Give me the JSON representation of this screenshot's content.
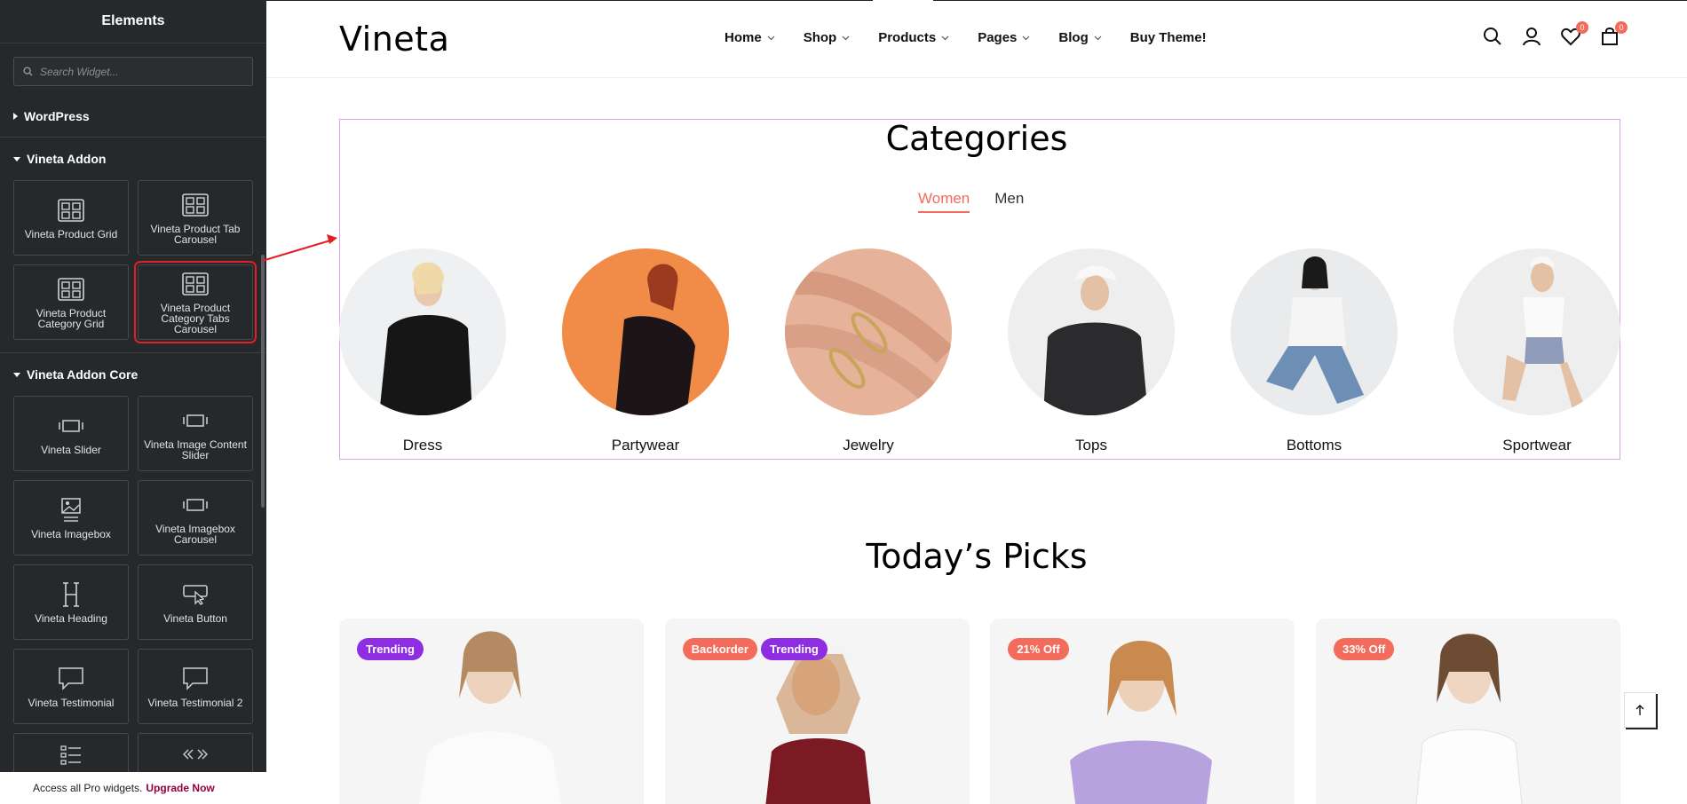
{
  "sidebar": {
    "title": "Elements",
    "search_placeholder": "Search Widget...",
    "categories": [
      {
        "label": "WordPress",
        "open": false
      },
      {
        "label": "Vineta Addon",
        "open": true
      },
      {
        "label": "Vineta Addon Core",
        "open": true
      }
    ],
    "vineta_addon_widgets": [
      {
        "label": "Vineta Product Grid",
        "icon": "product-grid-icon"
      },
      {
        "label": "Vineta Product Tab Carousel",
        "icon": "product-grid-icon"
      },
      {
        "label": "Vineta Product Category Grid",
        "icon": "product-grid-icon"
      },
      {
        "label": "Vineta Product Category Tabs Carousel",
        "icon": "product-grid-icon",
        "selected": true
      }
    ],
    "core_widgets": [
      {
        "label": "Vineta Slider",
        "icon": "slider-icon"
      },
      {
        "label": "Vineta Image Content Slider",
        "icon": "slider-icon"
      },
      {
        "label": "Vineta Imagebox",
        "icon": "image-icon"
      },
      {
        "label": "Vineta Imagebox Carousel",
        "icon": "slider-icon"
      },
      {
        "label": "Vineta Heading",
        "icon": "heading-icon"
      },
      {
        "label": "Vineta Button",
        "icon": "button-pointer-icon"
      },
      {
        "label": "Vineta Testimonial",
        "icon": "speech-bubble-icon"
      },
      {
        "label": "Vineta Testimonial 2",
        "icon": "speech-bubble-icon"
      }
    ],
    "footer_text": "Access all Pro widgets.",
    "footer_link": "Upgrade Now"
  },
  "header": {
    "logo": "Vineta",
    "nav": [
      {
        "label": "Home",
        "dropdown": true
      },
      {
        "label": "Shop",
        "dropdown": true
      },
      {
        "label": "Products",
        "dropdown": true
      },
      {
        "label": "Pages",
        "dropdown": true
      },
      {
        "label": "Blog",
        "dropdown": true
      },
      {
        "label": "Buy Theme!",
        "dropdown": false
      }
    ],
    "wishlist_count": "0",
    "cart_count": "0"
  },
  "categories_section": {
    "title": "Categories",
    "tabs": [
      {
        "label": "Women",
        "active": true
      },
      {
        "label": "Men",
        "active": false
      }
    ],
    "items": [
      "Dress",
      "Partywear",
      "Jewelry",
      "Tops",
      "Bottoms",
      "Sportwear"
    ]
  },
  "picks_section": {
    "title": "Today’s Picks",
    "products": [
      {
        "tags": [
          {
            "label": "Trending",
            "color": "#8e2de2"
          }
        ]
      },
      {
        "tags": [
          {
            "label": "Backorder",
            "color": "#f26b5b"
          },
          {
            "label": "Trending",
            "color": "#8e2de2"
          }
        ]
      },
      {
        "tags": [
          {
            "label": "21% Off",
            "color": "#f26b5b"
          }
        ]
      },
      {
        "tags": [
          {
            "label": "33% Off",
            "color": "#f26b5b"
          }
        ]
      }
    ]
  },
  "colors": {
    "accent": "#f26b5b",
    "trending": "#8e2de2",
    "editor_bg": "#26292c",
    "selection_outline": "#e31e24"
  }
}
